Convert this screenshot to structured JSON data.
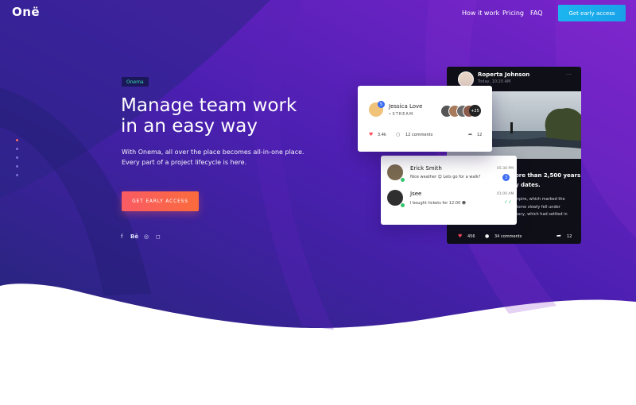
{
  "brand": {
    "logo": "Onë"
  },
  "nav": {
    "items": [
      "How it work",
      "Pricing",
      "FAQ"
    ],
    "cta": "Get early access"
  },
  "hero": {
    "badge": "Onema",
    "headline": [
      "Manage team work",
      "in an easy way"
    ],
    "subtitle": [
      "With Onema, all over the place becomes all-in-one place.",
      "Every part of a project lifecycle is here."
    ],
    "cta": "GET EARLY ACCESS",
    "social_icons": [
      "facebook-icon",
      "behance-icon",
      "dribbble-icon",
      "instagram-icon"
    ]
  },
  "post_card": {
    "author": "Roperta Johnson",
    "meta": "Today, 10:20 AM",
    "headline": [
      "ore than 2,500 years.",
      "y dates."
    ],
    "body": [
      "mpire, which marked the",
      "Rome slowly fell under",
      "nacy, which had settled in"
    ],
    "likes": "456",
    "comments": "34 comments",
    "shares": "12"
  },
  "stream_card": {
    "user": "Jessica Love",
    "tag": "STREAM",
    "badge_count": "5",
    "extra_members": "+25",
    "likes": "3.4k",
    "comments": "12 comments",
    "shares": "12"
  },
  "chat_card": {
    "messages": [
      {
        "name": "Erick Smith",
        "text": "Nice weather 😊 Lets go for a walk?",
        "time": "05:30 PM",
        "unread": "3"
      },
      {
        "name": "Jsee",
        "text": "I bought tickets for 12:00 ☻",
        "time": "01:00 AM"
      }
    ]
  },
  "colors": {
    "accent_cta": "#1ab0ee",
    "accent_main_cta": "#f95b64",
    "badge_text": "#39e0a8",
    "hero_gradient": [
      "#1f1f6e",
      "#6d1fc9"
    ]
  }
}
